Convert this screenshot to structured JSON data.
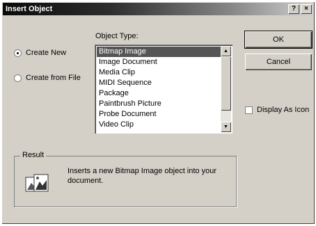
{
  "dialog": {
    "title": "Insert Object",
    "help_button": "?",
    "close_button": "×"
  },
  "options": {
    "create_new": "Create New",
    "create_from_file": "Create from File",
    "selected": "create_new"
  },
  "object_type": {
    "label": "Object Type:",
    "items": [
      "Bitmap Image",
      "Image Document",
      "Media Clip",
      "MIDI Sequence",
      "Package",
      "Paintbrush Picture",
      "Probe Document",
      "Video Clip"
    ],
    "selected_index": 0
  },
  "buttons": {
    "ok": "OK",
    "cancel": "Cancel"
  },
  "display_as_icon": {
    "label": "Display As Icon",
    "checked": false
  },
  "result": {
    "label": "Result",
    "text": "Inserts a new Bitmap Image object into your document.",
    "icon": "insert-bitmap-icon"
  },
  "colors": {
    "dialog_face": "#d4d0c8",
    "selection": "#555555"
  }
}
